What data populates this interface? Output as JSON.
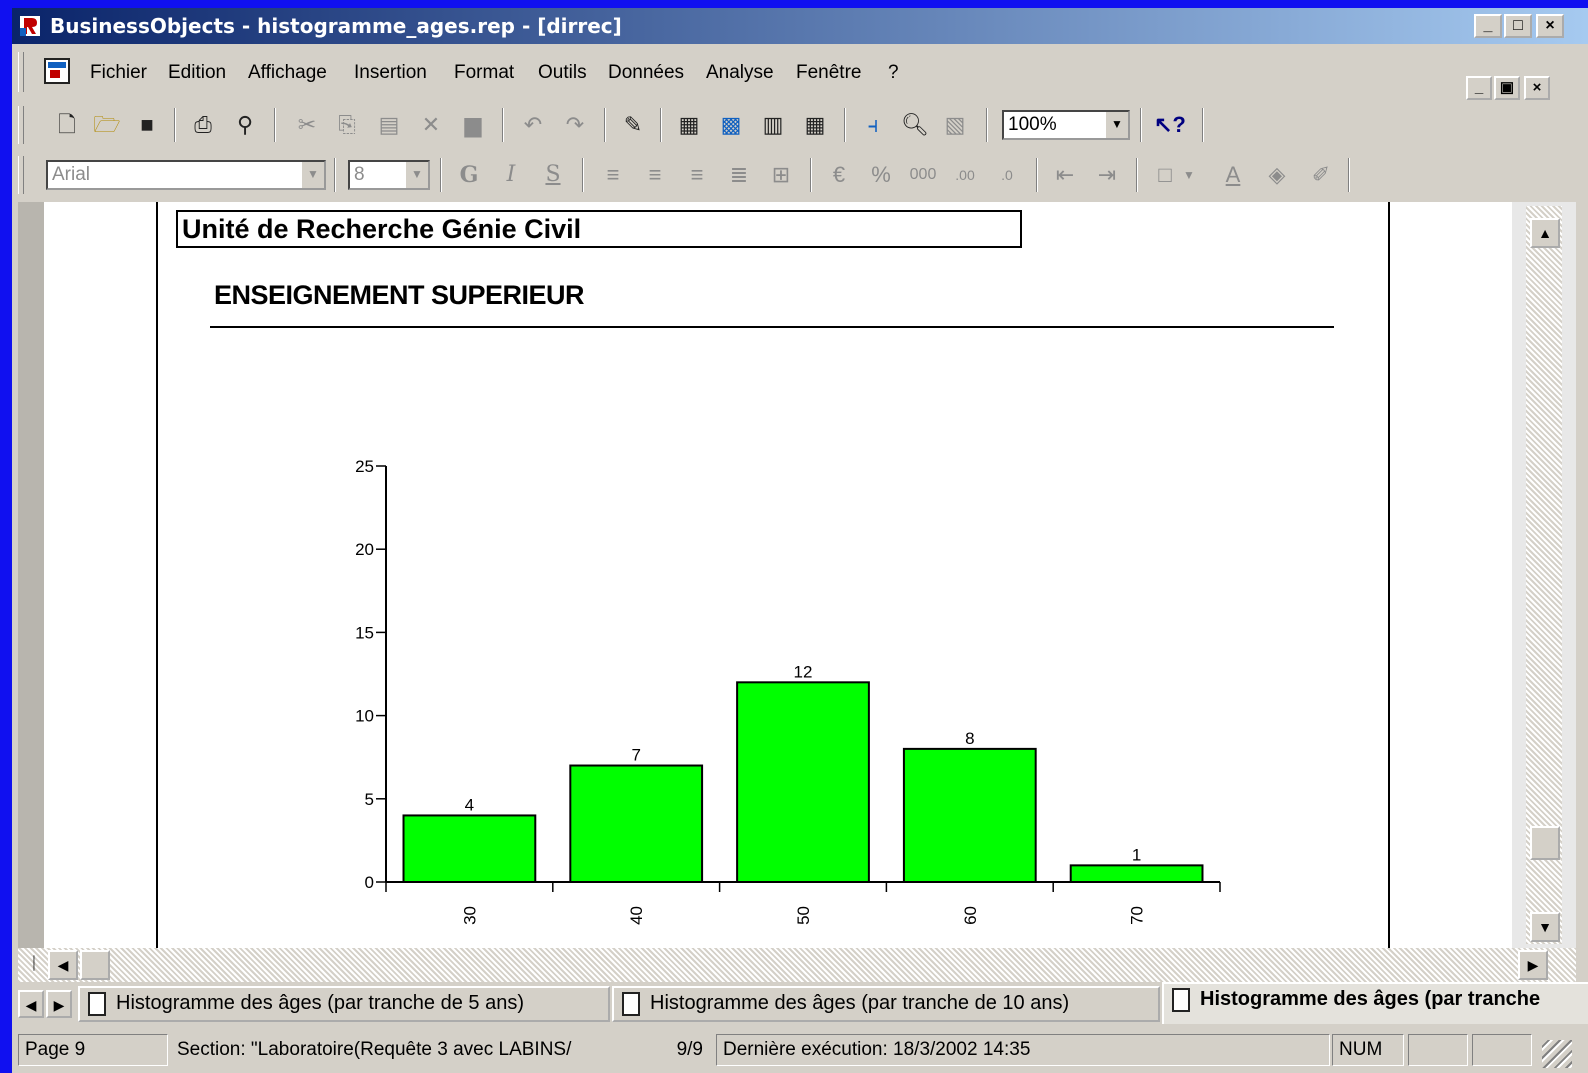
{
  "window": {
    "title": "BusinessObjects - histogramme_ages.rep - [dirrec]"
  },
  "menu": [
    "Fichier",
    "Edition",
    "Affichage",
    "Insertion",
    "Format",
    "Outils",
    "Données",
    "Analyse",
    "Fenêtre",
    "?"
  ],
  "toolbar": {
    "zoom": "100%"
  },
  "format_toolbar": {
    "font": "Arial",
    "size": "8",
    "bold_label": "G",
    "italic_label": "I",
    "underline_label": "S"
  },
  "report": {
    "header": "Unité de Recherche Génie Civil",
    "section_title": "ENSEIGNEMENT SUPERIEUR"
  },
  "chart_data": {
    "type": "bar",
    "categories": [
      "30",
      "40",
      "50",
      "60",
      "70"
    ],
    "values": [
      4,
      7,
      12,
      8,
      1
    ],
    "ylim": [
      0,
      25
    ],
    "yticks": [
      0,
      5,
      10,
      15,
      20,
      25
    ],
    "bar_color": "#00ff00",
    "data_labels": true,
    "grid": false
  },
  "tabs": [
    "Histogramme des âges (par tranche de 5 ans)",
    "Histogramme des âges (par tranche de 10 ans)",
    "Histogramme des âges (par tranche"
  ],
  "status": {
    "page": "Page 9",
    "section": "Section: \"Laboratoire(Requête 3 avec LABINS/",
    "pages": "9/9",
    "last_run": "Dernière exécution: 18/3/2002  14:35",
    "num": "NUM"
  }
}
